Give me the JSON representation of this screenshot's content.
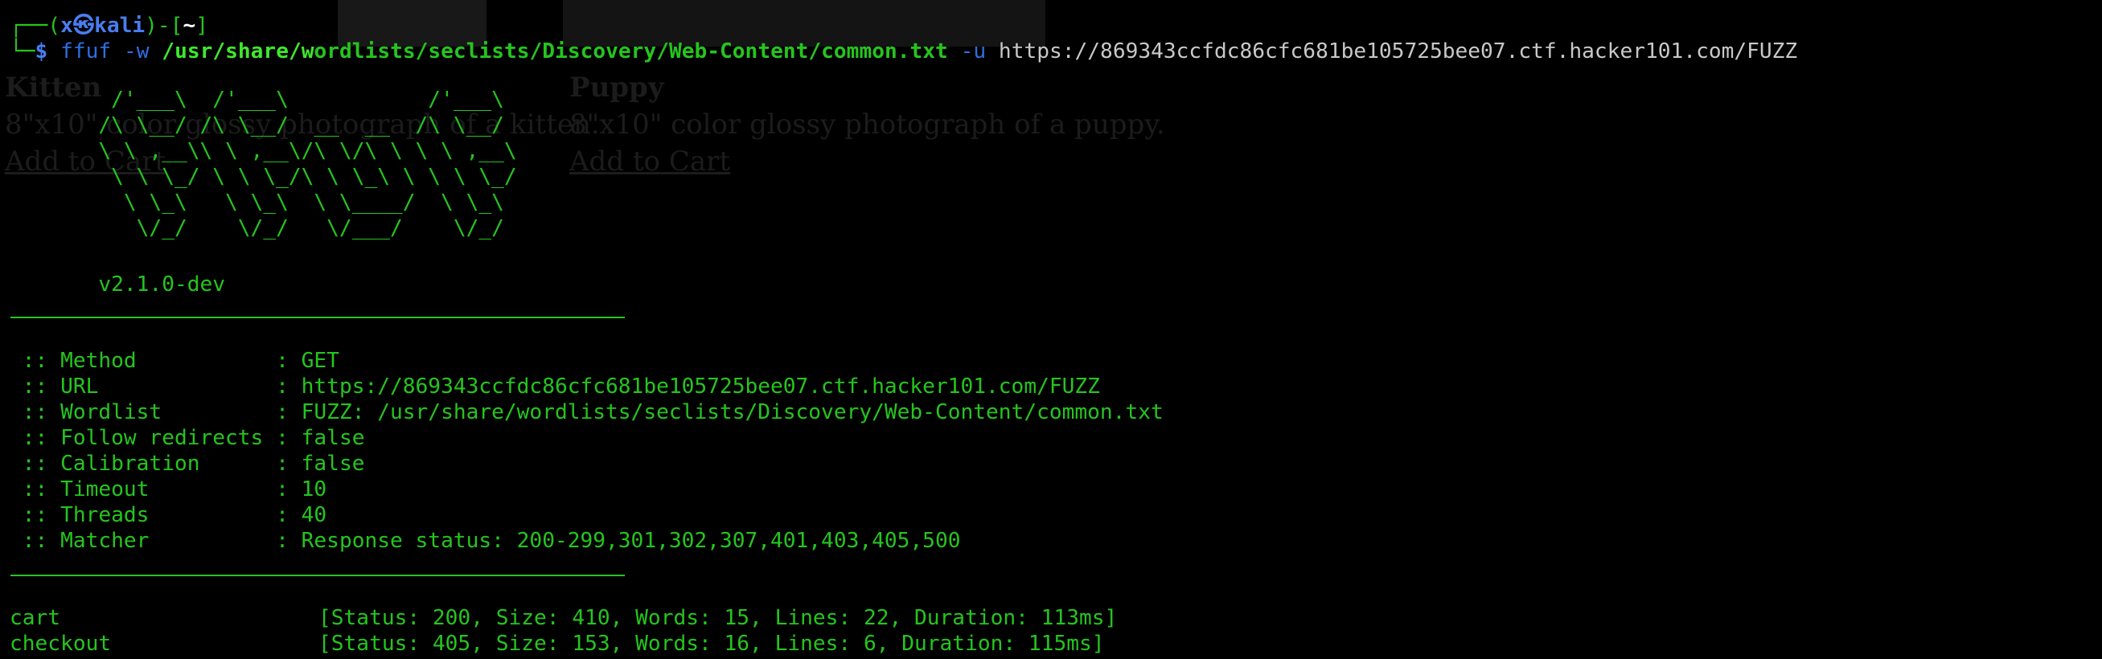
{
  "prompt": {
    "corner_top": "┌──",
    "corner_bottom": "└─",
    "paren_open": "(",
    "user": "x",
    "at_symbol": "㉿",
    "host": "kali",
    "paren_close": ")",
    "dash": "-",
    "bracket_open": "[",
    "cwd": "~",
    "bracket_close": "]",
    "symbol": "$"
  },
  "command": {
    "program": "ffuf",
    "flag_w": "-w",
    "wordlist_prefix": "/usr/share/w",
    "wordlist_rest": "ordlists/seclists/Discovery/Web-Content/common.txt",
    "flag_u": "-u",
    "url": "https://869343ccfdc86cfc681be105725bee07.ctf.hacker101.com/FUZZ"
  },
  "ascii_banner": "        /'___\\  /'___\\           /'___\\       \n       /\\ \\__/ /\\ \\__/  __  __  /\\ \\__/       \n       \\ \\ ,__\\\\ \\ ,__\\/\\ \\/\\ \\ \\ \\ ,__\\      \n        \\ \\ \\_/ \\ \\ \\_/\\ \\ \\_\\ \\ \\ \\ \\_/      \n         \\ \\_\\   \\ \\_\\  \\ \\____/  \\ \\_\\       \n          \\/_/    \\/_/   \\/___/    \\/_/       ",
  "version": "v2.1.0-dev",
  "config": [
    {
      "key": " :: Method           ",
      "value": "GET"
    },
    {
      "key": " :: URL              ",
      "value": "https://869343ccfdc86cfc681be105725bee07.ctf.hacker101.com/FUZZ"
    },
    {
      "key": " :: Wordlist         ",
      "value": "FUZZ: /usr/share/wordlists/seclists/Discovery/Web-Content/common.txt"
    },
    {
      "key": " :: Follow redirects ",
      "value": "false"
    },
    {
      "key": " :: Calibration      ",
      "value": "false"
    },
    {
      "key": " :: Timeout          ",
      "value": "10"
    },
    {
      "key": " :: Threads          ",
      "value": "40"
    },
    {
      "key": " :: Matcher          ",
      "value": "Response status: 200-299,301,302,307,401,403,405,500"
    }
  ],
  "config_separator": ": ",
  "results": [
    {
      "word": "cart",
      "info": "[Status: 200, Size: 410, Words: 15, Lines: 22, Duration: 113ms]"
    },
    {
      "word": "checkout",
      "info": "[Status: 405, Size: 153, Words: 16, Lines: 6, Duration: 115ms]"
    }
  ],
  "ghost_page": {
    "products": [
      {
        "title": "Kitten",
        "desc": "8\"x10\" color glossy photograph of a kitten.",
        "link": "Add to Cart"
      },
      {
        "title": "Puppy",
        "desc": "8\"x10\" color glossy photograph of a puppy.",
        "link": "Add to Cart"
      }
    ]
  },
  "colors": {
    "background": "#000000",
    "terminal_green": "#25c51e",
    "prompt_blue": "#2f6ee0",
    "url_grey": "#c8c8c8"
  }
}
